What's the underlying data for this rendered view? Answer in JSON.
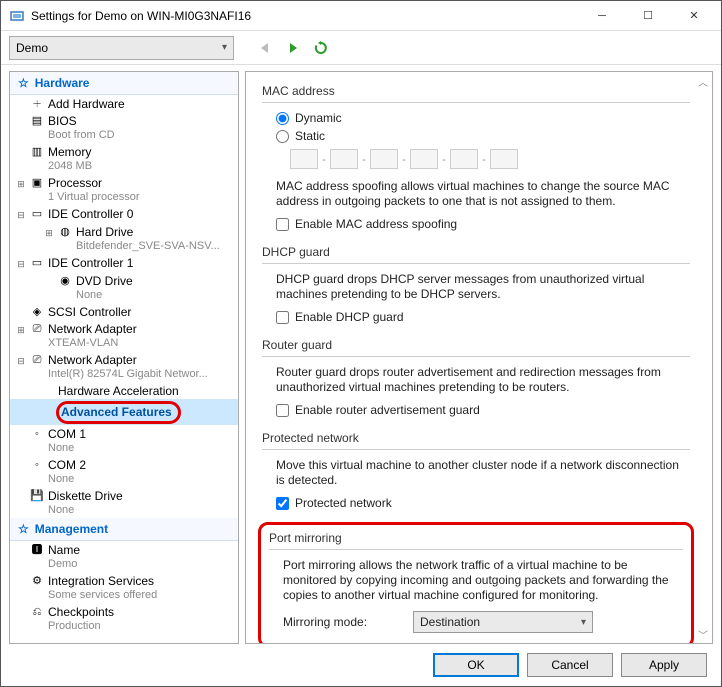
{
  "window": {
    "title": "Settings for Demo on WIN-MI0G3NAFI16"
  },
  "toolbar": {
    "vm_selector": "Demo"
  },
  "tree": {
    "sections": {
      "hardware": "Hardware",
      "management": "Management"
    },
    "items": [
      {
        "id": "add",
        "label": "Add Hardware",
        "sub": ""
      },
      {
        "id": "bios",
        "label": "BIOS",
        "sub": "Boot from CD"
      },
      {
        "id": "memory",
        "label": "Memory",
        "sub": "2048 MB"
      },
      {
        "id": "proc",
        "label": "Processor",
        "sub": "1 Virtual processor"
      },
      {
        "id": "ide0",
        "label": "IDE Controller 0",
        "sub": ""
      },
      {
        "id": "hdd",
        "label": "Hard Drive",
        "sub": "Bitdefender_SVE-SVA-NSV..."
      },
      {
        "id": "ide1",
        "label": "IDE Controller 1",
        "sub": ""
      },
      {
        "id": "dvd",
        "label": "DVD Drive",
        "sub": "None"
      },
      {
        "id": "scsi",
        "label": "SCSI Controller",
        "sub": ""
      },
      {
        "id": "nic1",
        "label": "Network Adapter",
        "sub": "XTEAM-VLAN"
      },
      {
        "id": "nic2",
        "label": "Network Adapter",
        "sub": "Intel(R) 82574L Gigabit Networ..."
      },
      {
        "id": "hwacc",
        "label": "Hardware Acceleration",
        "sub": ""
      },
      {
        "id": "adv",
        "label": "Advanced Features",
        "sub": ""
      },
      {
        "id": "com1",
        "label": "COM 1",
        "sub": "None"
      },
      {
        "id": "com2",
        "label": "COM 2",
        "sub": "None"
      },
      {
        "id": "disk",
        "label": "Diskette Drive",
        "sub": "None"
      },
      {
        "id": "name",
        "label": "Name",
        "sub": "Demo"
      },
      {
        "id": "integ",
        "label": "Integration Services",
        "sub": "Some services offered"
      },
      {
        "id": "check",
        "label": "Checkpoints",
        "sub": "Production"
      }
    ]
  },
  "content": {
    "mac": {
      "title": "MAC address",
      "opt_dynamic": "Dynamic",
      "opt_static": "Static",
      "desc": "MAC address spoofing allows virtual machines to change the source MAC address in outgoing packets to one that is not assigned to them.",
      "check": "Enable MAC address spoofing"
    },
    "dhcp": {
      "title": "DHCP guard",
      "desc": "DHCP guard drops DHCP server messages from unauthorized virtual machines pretending to be DHCP servers.",
      "check": "Enable DHCP guard"
    },
    "router": {
      "title": "Router guard",
      "desc": "Router guard drops router advertisement and redirection messages from unauthorized virtual machines pretending to be routers.",
      "check": "Enable router advertisement guard"
    },
    "protected": {
      "title": "Protected network",
      "desc": "Move this virtual machine to another cluster node if a network disconnection is detected.",
      "check": "Protected network"
    },
    "mirror": {
      "title": "Port mirroring",
      "desc": "Port mirroring allows the network traffic of a virtual machine to be monitored by copying incoming and outgoing packets and forwarding the copies to another virtual machine configured for monitoring.",
      "mode_label": "Mirroring mode:",
      "mode_value": "Destination"
    }
  },
  "buttons": {
    "ok": "OK",
    "cancel": "Cancel",
    "apply": "Apply"
  }
}
